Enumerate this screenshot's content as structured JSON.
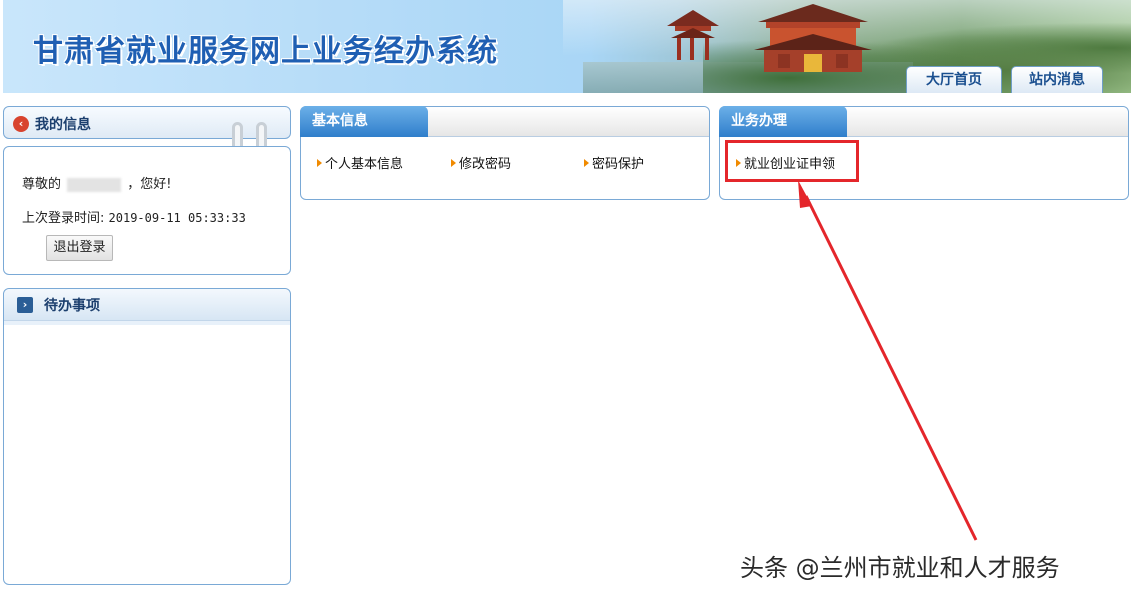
{
  "header": {
    "title": "甘肃省就业服务网上业务经办系统",
    "tabs": [
      {
        "label": "大厅首页"
      },
      {
        "label": "站内消息"
      }
    ]
  },
  "my_info": {
    "title": "我的信息",
    "greeting_prefix": "尊敬的",
    "greeting_suffix": "，您好!",
    "last_login_label": "上次登录时间:",
    "last_login_value": "2019-09-11 05:33:33",
    "logout_label": "退出登录"
  },
  "todo": {
    "title": "待办事项"
  },
  "basic_info": {
    "title": "基本信息",
    "links": [
      {
        "label": "个人基本信息"
      },
      {
        "label": "修改密码"
      },
      {
        "label": "密码保护"
      }
    ]
  },
  "business": {
    "title": "业务办理",
    "links": [
      {
        "label": "就业创业证申领"
      }
    ]
  },
  "annotation": {
    "highlight_color": "#e4262b"
  },
  "watermark": {
    "text": "头条 @兰州市就业和人才服务"
  }
}
